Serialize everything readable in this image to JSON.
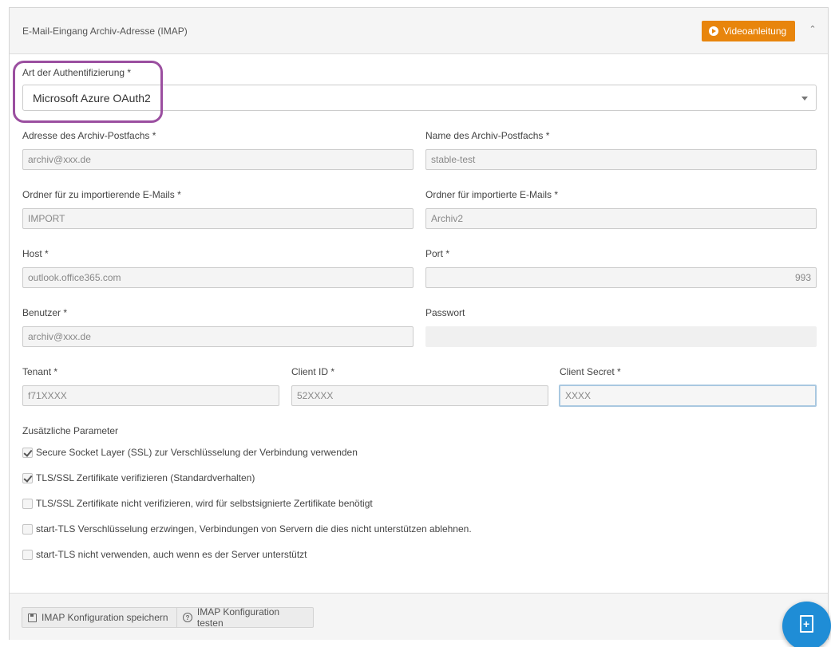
{
  "header": {
    "title": "E-Mail-Eingang Archiv-Adresse (IMAP)",
    "video_button": "Videoanleitung"
  },
  "auth": {
    "label": "Art der Authentifizierung  *",
    "value": "Microsoft Azure OAuth2"
  },
  "fields": {
    "mailbox_address": {
      "label": "Adresse des Archiv-Postfachs *",
      "value": "archiv@xxx.de"
    },
    "mailbox_name": {
      "label": "Name des Archiv-Postfachs  *",
      "value": "stable-test"
    },
    "import_folder": {
      "label": "Ordner für zu importierende E-Mails  *",
      "value": "IMPORT"
    },
    "imported_folder": {
      "label": "Ordner für importierte E-Mails  *",
      "value": "Archiv2"
    },
    "host": {
      "label": "Host *",
      "value": "outlook.office365.com"
    },
    "port": {
      "label": "Port *",
      "value": "993"
    },
    "user": {
      "label": "Benutzer *",
      "value": "archiv@xxx.de"
    },
    "password": {
      "label": "Passwort",
      "value": ""
    },
    "tenant": {
      "label": "Tenant *",
      "value": "f71XXXX"
    },
    "client_id": {
      "label": "Client ID *",
      "value": "52XXXX"
    },
    "client_secret": {
      "label": "Client Secret *",
      "value": "XXXX"
    }
  },
  "params": {
    "title": "Zusätzliche Parameter",
    "options": [
      {
        "label": "Secure Socket Layer (SSL) zur Verschlüsselung der Verbindung verwenden",
        "checked": true
      },
      {
        "label": "TLS/SSL Zertifikate verifizieren (Standardverhalten)",
        "checked": true
      },
      {
        "label": "TLS/SSL Zertifikate nicht verifizieren, wird für selbstsignierte Zertifikate benötigt",
        "checked": false
      },
      {
        "label": "start-TLS Verschlüsselung erzwingen, Verbindungen von Servern die dies nicht unterstützen ablehnen.",
        "checked": false
      },
      {
        "label": "start-TLS nicht verwenden, auch wenn es der Server unterstützt",
        "checked": false
      }
    ]
  },
  "footer": {
    "save_label": "IMAP Konfiguration speichern",
    "test_label": "IMAP Konfiguration testen"
  },
  "icons": {
    "play": "play-icon",
    "collapse": "chevron-up-icon",
    "save": "floppy-icon",
    "test": "help-icon",
    "fab": "new-document-icon"
  },
  "colors": {
    "video_button": "#e8850c",
    "highlight": "#9b4fa0",
    "fab": "#1f8dd6"
  }
}
